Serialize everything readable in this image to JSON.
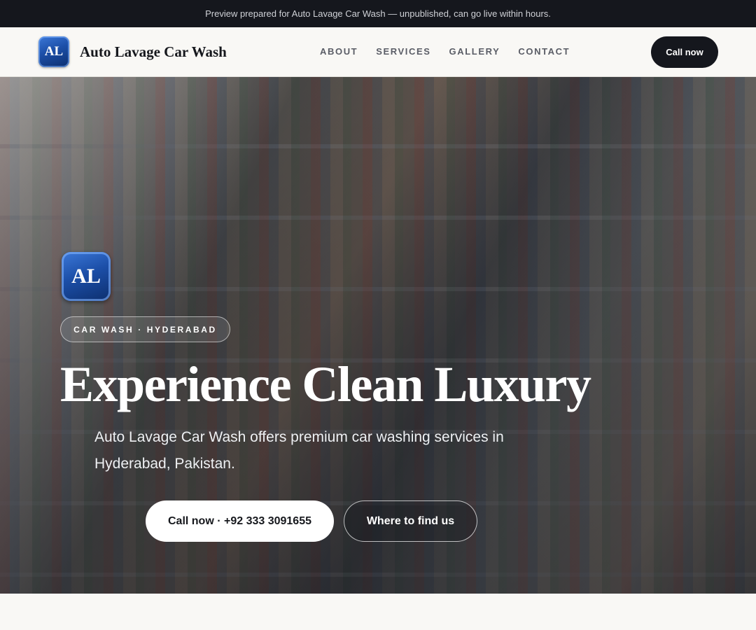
{
  "announcement": "Preview prepared for Auto Lavage Car Wash — unpublished, can go live within hours.",
  "header": {
    "logo_initials": "AL",
    "brand_name": "Auto Lavage Car Wash",
    "nav": [
      "ABOUT",
      "SERVICES",
      "GALLERY",
      "CONTACT"
    ],
    "cta_label": "Call now"
  },
  "hero": {
    "logo_initials": "AL",
    "eyebrow": "CAR WASH · HYDERABAD",
    "title": "Experience Clean Luxury",
    "subtitle": "Auto Lavage Car Wash offers premium car washing services in Hyderabad, Pakistan.",
    "primary_cta": "Call now · +92 333 3091655",
    "secondary_cta": "Where to find us"
  },
  "colors": {
    "dark": "#15171d",
    "page_bg": "#f9f8f5",
    "logo_blue": "#1c4fa8"
  }
}
